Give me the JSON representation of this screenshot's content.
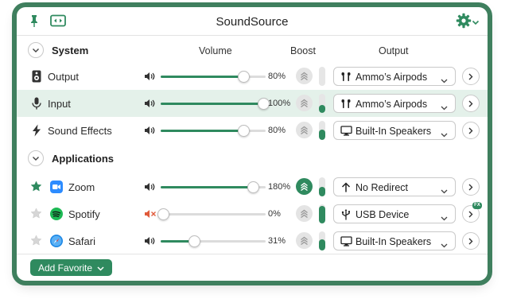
{
  "window": {
    "title": "SoundSource"
  },
  "columns": {
    "volume": "Volume",
    "boost": "Boost",
    "output": "Output"
  },
  "sections": {
    "system": "System",
    "applications": "Applications"
  },
  "system_rows": [
    {
      "label": "Output",
      "volume_pct": 80,
      "volume_text": "80%",
      "boost_on": false,
      "level": 0.0,
      "output": "Ammo’s Airpods",
      "output_icon": "airpods-icon"
    },
    {
      "label": "Input",
      "volume_pct": 100,
      "volume_text": "100%",
      "boost_on": false,
      "level": 0.4,
      "output": "Ammo’s Airpods",
      "output_icon": "airpods-icon",
      "selected": true
    },
    {
      "label": "Sound Effects",
      "volume_pct": 80,
      "volume_text": "80%",
      "boost_on": false,
      "level": 0.55,
      "output": "Built-In Speakers",
      "output_icon": "display-icon"
    }
  ],
  "app_rows": [
    {
      "label": "Zoom",
      "favorite": true,
      "volume_pct": 90,
      "volume_text": "180%",
      "boost_on": true,
      "level": 0.5,
      "output": "No Redirect",
      "output_icon": "arrow-up-icon"
    },
    {
      "label": "Spotify",
      "favorite": false,
      "muted": true,
      "volume_pct": 0,
      "volume_text": "0%",
      "boost_on": false,
      "level": 0.9,
      "output": "USB Device",
      "output_icon": "usb-icon",
      "fx": "FX"
    },
    {
      "label": "Safari",
      "favorite": false,
      "volume_pct": 31,
      "volume_text": "31%",
      "boost_on": false,
      "level": 0.6,
      "output": "Built-In Speakers",
      "output_icon": "display-icon"
    }
  ],
  "footer": {
    "add_favorite": "Add Favorite"
  },
  "colors": {
    "accent": "#2f8a5f",
    "selected_row": "#e4f1ea",
    "muted": "#e05a3a"
  }
}
